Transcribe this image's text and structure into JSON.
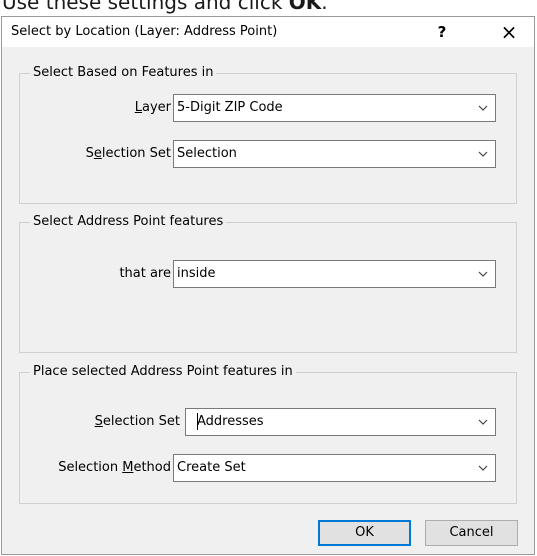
{
  "caption": {
    "text": "Use these settings and click ",
    "emphasis": "OK",
    "suffix": "."
  },
  "dialog": {
    "title": "Select by Location (Layer: Address Point)",
    "help_label": "?",
    "close_label": "×"
  },
  "group_based_on": {
    "legend": "Select Based on Features in",
    "layer": {
      "label_pre": "",
      "label_accel": "L",
      "label_post": "ayer",
      "value": "5-Digit ZIP Code"
    },
    "selection_set": {
      "label_pre": "S",
      "label_accel": "e",
      "label_post": "lection Set",
      "value": "Selection"
    }
  },
  "group_select": {
    "legend": "Select Address Point features",
    "that_are": {
      "label": "that are",
      "value": "inside"
    }
  },
  "group_place": {
    "legend": "Place selected Address Point features in",
    "selection_set": {
      "label_pre": "",
      "label_accel": "S",
      "label_post": "election Set",
      "value": "Addresses"
    },
    "selection_method": {
      "label_pre": "Selection ",
      "label_accel": "M",
      "label_post": "ethod",
      "value": "Create Set"
    }
  },
  "buttons": {
    "ok": "OK",
    "cancel": "Cancel"
  },
  "icons": {
    "dropdown": "chevron-down-icon",
    "help": "help-icon",
    "close": "close-icon"
  },
  "colors": {
    "default_button_border": "#0078d7",
    "dialog_bg": "#f0f0f0"
  }
}
